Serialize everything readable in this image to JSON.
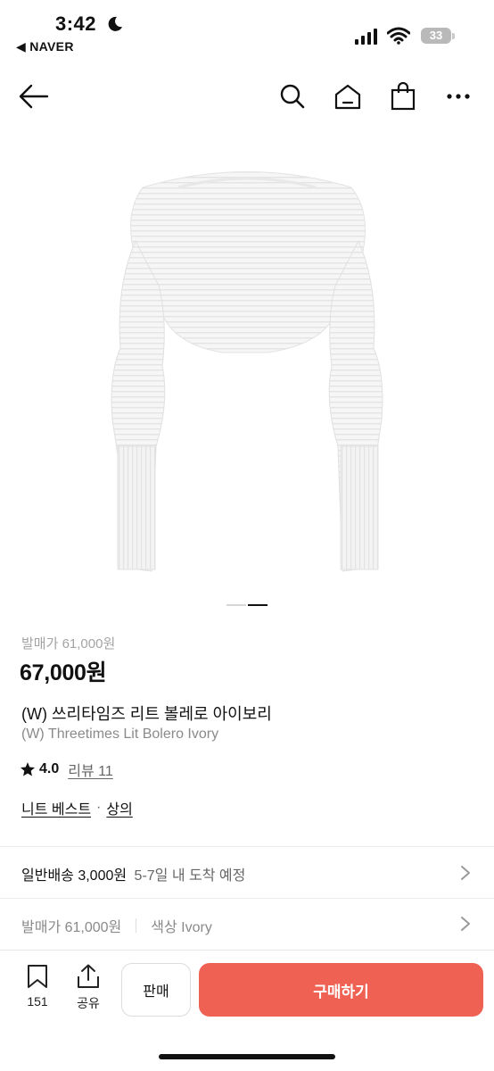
{
  "status_bar": {
    "time": "3:42",
    "back_app": "◀ NAVER",
    "battery": "33"
  },
  "nav": {
    "back_icon": "arrow-left-icon",
    "search_icon": "search-icon",
    "home_icon": "home-icon",
    "bag_icon": "shopping-bag-icon",
    "more_icon": "more-icon"
  },
  "carousel": {
    "slides": 2,
    "active": 2
  },
  "product": {
    "list_price": "발매가 61,000원",
    "sale_price": "67,000원",
    "name_ko": "(W) 쓰리타임즈 리트 볼레로 아이보리",
    "name_en": "(W) Threetimes Lit Bolero Ivory",
    "rating": "4.0",
    "review": "리뷰 11",
    "category_1": "니트 베스트",
    "category_sep": "·",
    "category_2": "상의"
  },
  "shipping": {
    "label": "일반배송 3,000원",
    "eta": "5-7일 내 도착 예정"
  },
  "info_row": {
    "release_price": "발매가 61,000원",
    "color": "색상 Ivory"
  },
  "bottom_bar": {
    "save_count": "151",
    "share_label": "공유",
    "sell_label": "판매",
    "buy_label": "구매하기"
  },
  "colors": {
    "accent": "#ef6253",
    "muted": "#a3a3a3"
  }
}
